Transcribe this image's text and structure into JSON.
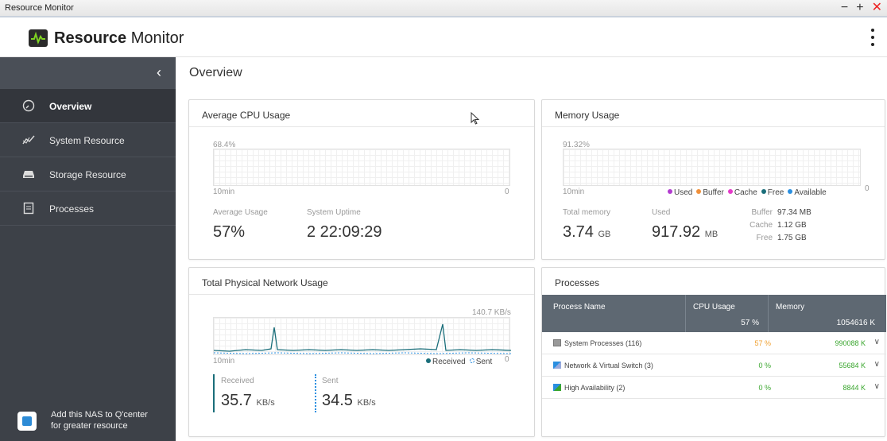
{
  "window": {
    "title": "Resource Monitor",
    "minimize": "−",
    "maximize": "+",
    "close": "✕"
  },
  "app": {
    "name_bold": "Resource",
    "name_light": "Monitor"
  },
  "sidebar": {
    "collapse": "‹",
    "items": [
      {
        "label": "Overview",
        "icon": "gauge-icon"
      },
      {
        "label": "System Resource",
        "icon": "trend-icon"
      },
      {
        "label": "Storage Resource",
        "icon": "storage-icon"
      },
      {
        "label": "Processes",
        "icon": "document-icon"
      }
    ],
    "promo_line1": "Add this NAS to Q'center",
    "promo_line2": "for greater resource"
  },
  "page_title": "Overview",
  "cpu": {
    "title": "Average CPU Usage",
    "peak": "68.4%",
    "x_left": "10min",
    "x_right": "0",
    "avg_label": "Average Usage",
    "avg_value": "57%",
    "uptime_label": "System Uptime",
    "uptime_value": "2 22:09:29"
  },
  "memory": {
    "title": "Memory Usage",
    "peak": "91.32%",
    "x_left": "10min",
    "x_right": "0",
    "legend": [
      {
        "label": "Used",
        "color": "#b23ccf"
      },
      {
        "label": "Buffer",
        "color": "#f0903a"
      },
      {
        "label": "Cache",
        "color": "#e53ac9"
      },
      {
        "label": "Free",
        "color": "#1a6e7a"
      },
      {
        "label": "Available",
        "color": "#2a8fe0"
      }
    ],
    "total_label": "Total memory",
    "total_value": "3.74",
    "total_unit": "GB",
    "used_label": "Used",
    "used_value": "917.92",
    "used_unit": "MB",
    "buffer_label": "Buffer",
    "buffer_value": "97.34 MB",
    "cache_label": "Cache",
    "cache_value": "1.12 GB",
    "free_label": "Free",
    "free_value": "1.75 GB"
  },
  "network": {
    "title": "Total Physical Network Usage",
    "peak": "140.7 KB/s",
    "x_left": "10min",
    "x_right": "0",
    "legend_received": "Received",
    "legend_sent": "Sent",
    "received_label": "Received",
    "received_value": "35.7",
    "received_unit": "KB/s",
    "sent_label": "Sent",
    "sent_value": "34.5",
    "sent_unit": "KB/s",
    "received_color": "#1a6e7a",
    "sent_color": "#2a8fe0"
  },
  "processes": {
    "title": "Processes",
    "col_name": "Process Name",
    "col_cpu": "CPU Usage",
    "col_mem": "Memory",
    "cpu_total": "57 %",
    "mem_total": "1054616 K",
    "rows": [
      {
        "name": "System Processes (116)",
        "cpu": "57 %",
        "cpu_color": "#f0a030",
        "mem": "990088 K",
        "icon": "system-processes-icon"
      },
      {
        "name": "Network & Virtual Switch (3)",
        "cpu": "0 %",
        "cpu_color": "#3aa62e",
        "mem": "55684 K",
        "icon": "network-switch-icon"
      },
      {
        "name": "High Availability (2)",
        "cpu": "0 %",
        "cpu_color": "#3aa62e",
        "mem": "8844 K",
        "icon": "high-availability-icon"
      }
    ]
  }
}
